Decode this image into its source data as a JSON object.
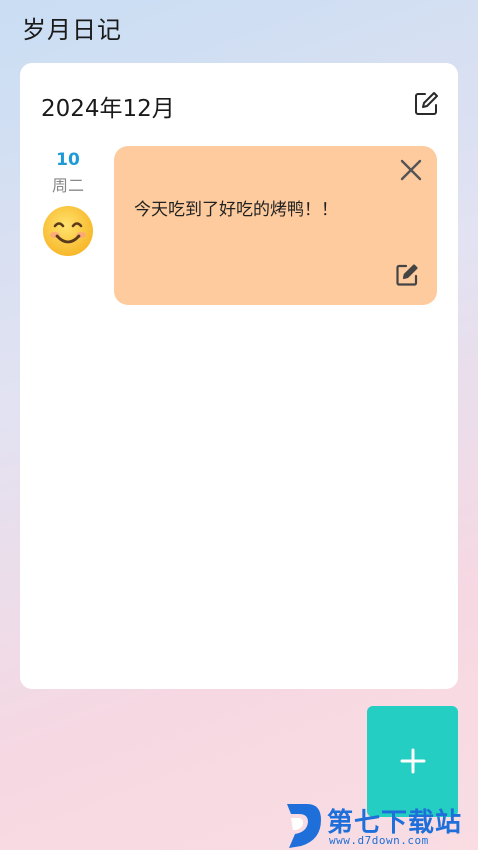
{
  "app": {
    "title": "岁月日记"
  },
  "month": {
    "title": "2024年12月",
    "edit_icon": "edit-square-icon"
  },
  "entries": [
    {
      "day": "10",
      "weekday": "周二",
      "mood_icon": "smiling-face-emoji",
      "text": "今天吃到了好吃的烤鸭！！",
      "card_color": "#fdcb9e",
      "close_icon": "close-icon",
      "edit_icon": "edit-icon"
    }
  ],
  "fab": {
    "icon": "plus-icon",
    "color": "#24cec2"
  },
  "watermark": {
    "name": "第七下载站",
    "url": "www.d7down.com"
  },
  "colors": {
    "accent_day": "#1e9bd7",
    "watermark": "#1e6fd9"
  }
}
